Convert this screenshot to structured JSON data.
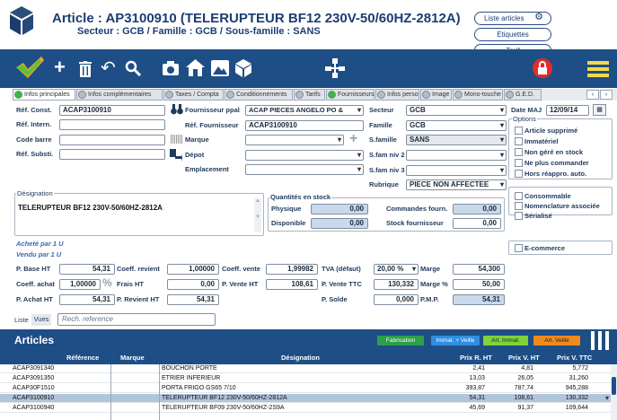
{
  "header": {
    "title": "Article : AP3100910 (TELERUPTEUR BF12 230V-50/60HZ-2812A)",
    "subtitle": "Secteur : GCB / Famille : GCB / Sous-famille : SANS",
    "buttons": [
      "Liste articles",
      "Etiquettes",
      "Tarif"
    ]
  },
  "tabs": [
    "Infos principales",
    "Infos complémentaires",
    "Taxes / Compta",
    "Conditionnements",
    "Tarifs",
    "Fournisseurs",
    "Infos perso",
    "Image",
    "Mono-touche",
    "G.E.D."
  ],
  "form": {
    "ref_const_label": "Réf. Const.",
    "ref_const": "ACAP3100910",
    "ref_intern_label": "Réf. Intern.",
    "code_barre_label": "Code barre",
    "ref_substi_label": "Réf. Substi.",
    "fournisseur_ppal_label": "Fournisseur ppal",
    "fournisseur_ppal": "ACAP PIECES ANGELO PO &",
    "ref_fournisseur_label": "Réf. Fournisseur",
    "ref_fournisseur": "ACAP3100910",
    "marque_label": "Marque",
    "depot_label": "Dépot",
    "emplacement_label": "Emplacement",
    "secteur_label": "Secteur",
    "secteur": "GCB",
    "famille_label": "Famille",
    "famille": "GCB",
    "sfamille_label": "S.famille",
    "sfamille": "SANS",
    "sfam2_label": "S.fam niv 2",
    "sfam3_label": "S.fam niv 3",
    "rubrique_label": "Rubrique",
    "rubrique": "PIECE NON AFFECTEE",
    "date_maj_label": "Date MAJ",
    "date_maj": "12/09/14",
    "options_label": "Options",
    "options": [
      "Article supprimé",
      "Immatériel",
      "Non géré en stock",
      "Ne plus commander",
      "Hors réappro. auto."
    ],
    "options2": [
      "Consommable",
      "Nomenclature associée",
      "Sérialisé"
    ],
    "ecommerce": "E-commerce",
    "designation_label": "Désignation",
    "designation": "TELERUPTEUR BF12 230V-50/60HZ-2812A",
    "quantites_label": "Quantités en stock",
    "physique_label": "Physique",
    "physique": "0,00",
    "disponible_label": "Disponible",
    "disponible": "0,00",
    "commandes_label": "Commandes fourn.",
    "commandes": "0,00",
    "stock_fourn_label": "Stock fournisseur",
    "stock_fourn": "0,00",
    "achete_par": "Acheté par 1 U",
    "vendu_par": "Vendu par 1 U",
    "pbase_label": "P. Base HT",
    "pbase": "54,31",
    "coeff_revient_label": "Coeff. revient",
    "coeff_revient": "1,00000",
    "coeff_vente_label": "Coeff. vente",
    "coeff_vente": "1,99982",
    "tva_label": "TVA (défaut)",
    "tva": "20,00 %",
    "marge_label": "Marge",
    "marge": "54,300",
    "coeff_achat_label": "Coeff. achat",
    "coeff_achat": "1,00000",
    "frais_label": "Frais HT",
    "frais": "0,00",
    "pvente_ht_label": "P. Vente HT",
    "pvente_ht": "108,61",
    "pvente_ttc_label": "P. Vente TTC",
    "pvente_ttc": "130,332",
    "marge_pct_label": "Marge %",
    "marge_pct": "50,00",
    "pachat_label": "P. Achat HT",
    "pachat": "54,31",
    "previent_label": "P. Revient HT",
    "previent": "54,31",
    "psolde_label": "P. Solde",
    "psolde": "0,000",
    "pmp_label": "P.M.P.",
    "pmp": "54,31"
  },
  "list": {
    "tab_liste": "Liste",
    "tab_vues": "Vues",
    "search_placeholder": "Rech. reference",
    "title": "Articles",
    "filters": [
      {
        "label": "Fabrication",
        "color": "#2e9e4a"
      },
      {
        "label": "Immat. + Veille",
        "color": "#2f8ee0"
      },
      {
        "label": "Art. Immat.",
        "color": "#7fd23a"
      },
      {
        "label": "Art. Veille",
        "color": "#f08a1c"
      }
    ],
    "columns": [
      "Référence",
      "Marque",
      "Désignation",
      "Prix R. HT",
      "Prix V. HT",
      "Prix V. TTC"
    ],
    "rows": [
      [
        "ACAP3091340",
        "",
        "BOUCHON PORTE",
        "2,41",
        "4,81",
        "5,772"
      ],
      [
        "ACAP3091350",
        "",
        "ETRIER INFERIEUR",
        "13,03",
        "26,05",
        "31,260"
      ],
      [
        "ACAP30F1510",
        "",
        "PORTA FRIGO GS65 7/10",
        "393,87",
        "787,74",
        "945,288"
      ],
      [
        "ACAP3100910",
        "",
        "TELERUPTEUR BF12 230V-50/60HZ-2812A",
        "54,31",
        "108,61",
        "130,332"
      ],
      [
        "ACAP3100940",
        "",
        "TELERUPTEUR BF09 230V-50/60HZ-2S9A",
        "45,69",
        "91,37",
        "109,644"
      ]
    ]
  }
}
